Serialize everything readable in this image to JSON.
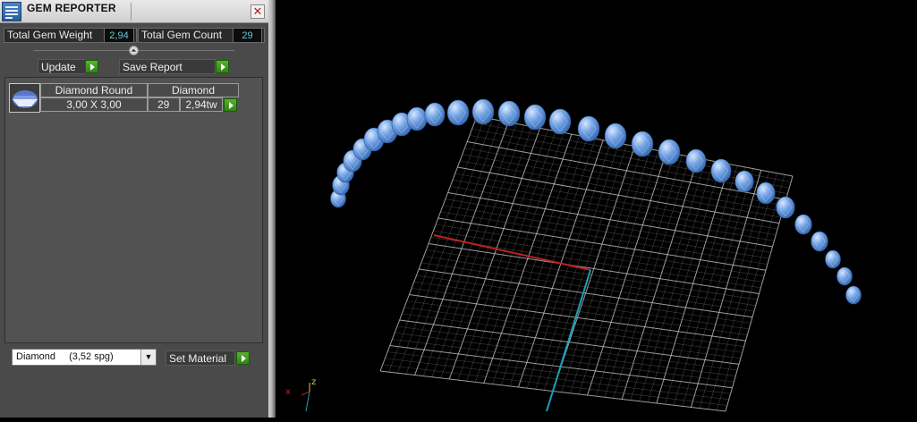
{
  "panel": {
    "title": "GEM REPORTER",
    "close_glyph": "✕",
    "total_weight_label": "Total Gem Weight",
    "total_weight_value": "2,94",
    "total_count_label": "Total Gem Count",
    "total_count_value": "29",
    "collapse_glyph": "⏶",
    "update_label": "Update",
    "save_report_label": "Save Report",
    "gem_row": {
      "shape": "Diamond Round",
      "material": "Diamond",
      "size": "3,00 X 3,00",
      "count": "29",
      "weight": "2,94tw"
    },
    "material_select_name": "Diamond",
    "material_select_detail": "(3,52 spg)",
    "set_material_label": "Set Material"
  },
  "viewport": {
    "axis_x_label": "x",
    "axis_z_label": "z",
    "axis_x_color": "#c02020",
    "axis_y_color": "#1ba0b8",
    "gem_color": "#7aa8e6",
    "grid_color": "#cfcfcf",
    "gem_count": 29
  },
  "icons": [
    "app-icon",
    "close-icon",
    "collapse-icon",
    "play-icon",
    "gem-thumbnail-icon",
    "dropdown-arrow-icon"
  ]
}
